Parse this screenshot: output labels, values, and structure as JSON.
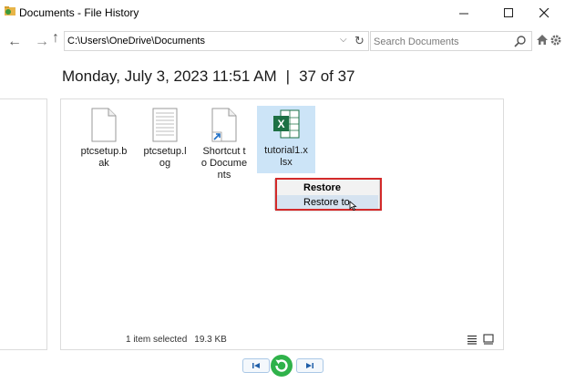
{
  "window": {
    "title": "Documents - File History",
    "minimize_icon": "minimize-icon",
    "maximize_icon": "maximize-icon",
    "close_icon": "close-icon"
  },
  "navigation": {
    "address": "C:\\Users\\OneDrive\\Documents",
    "search_placeholder": "Search Documents"
  },
  "header": {
    "date": "Monday, July 3, 2023 11:51 AM",
    "separator": "|",
    "position": "37 of 37"
  },
  "files": [
    {
      "name": "ptcsetup.bak",
      "icon": "blank-file-icon",
      "selected": false
    },
    {
      "name": "ptcsetup.log",
      "icon": "text-file-icon",
      "selected": false
    },
    {
      "name": "Shortcut to Documents",
      "icon": "shortcut-file-icon",
      "selected": false
    },
    {
      "name": "tutorial1.xlsx",
      "icon": "excel-file-icon",
      "selected": true
    }
  ],
  "context_menu": {
    "items": [
      {
        "label": "Restore",
        "bold": true
      },
      {
        "label": "Restore to",
        "highlighted": true
      }
    ]
  },
  "status": {
    "selected": "1 item selected",
    "size": "19.3 KB"
  },
  "colors": {
    "selection": "#cce4f7",
    "highlight_box": "#d32a2a",
    "excel_green": "#1d7044",
    "restore_green": "#2fb24a"
  }
}
